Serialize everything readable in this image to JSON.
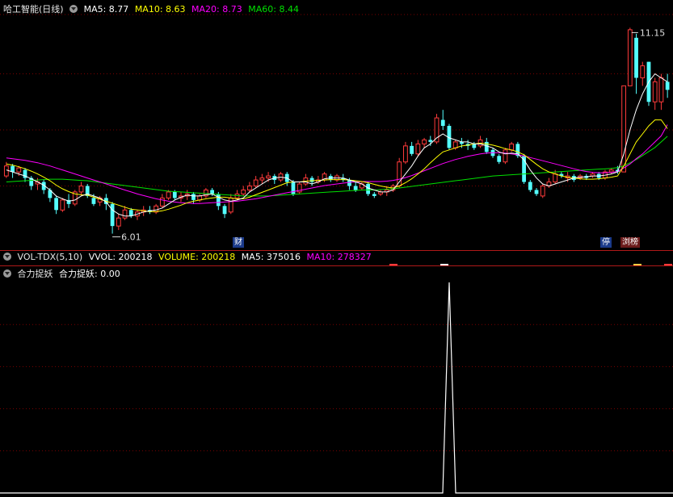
{
  "main_header": {
    "title": "哈工智能(日线)",
    "ma5": "MA5: 8.77",
    "ma10": "MA10: 8.63",
    "ma20": "MA20: 8.73",
    "ma60": "MA60: 8.44"
  },
  "vol_header": {
    "name": "VOL-TDX(5,10)",
    "vvol": "VVOL: 200218",
    "volume": "VOLUME: 200218",
    "ma5": "MA5: 375016",
    "ma10": "MA10: 278327"
  },
  "ind_header": {
    "name": "合力捉妖",
    "value": "合力捉妖: 0.00"
  },
  "badges": {
    "cai": "财",
    "ting": "停",
    "liubang": "浏榜"
  },
  "colors": {
    "up": "#ff3b3b",
    "down": "#54ffff",
    "ma5": "#ffffff",
    "ma10": "#ffff00",
    "ma20": "#ff00ff",
    "ma60": "#00e000",
    "grid": "#7a0000"
  },
  "chart_data": [
    {
      "type": "candlestick",
      "title": "哈工智能(日线)",
      "ylim": [
        5.8,
        11.4
      ],
      "annotations": {
        "high": "11.15",
        "low": "6.01"
      },
      "candles": [
        [
          7.45,
          7.7,
          7.4,
          7.8
        ],
        [
          7.7,
          7.55,
          7.4,
          7.75
        ],
        [
          7.55,
          7.65,
          7.45,
          7.7
        ],
        [
          7.6,
          7.4,
          7.3,
          7.65
        ],
        [
          7.4,
          7.2,
          7.1,
          7.45
        ],
        [
          7.25,
          7.3,
          7.1,
          7.4
        ],
        [
          7.3,
          7.1,
          7.0,
          7.35
        ],
        [
          7.1,
          6.9,
          6.8,
          7.15
        ],
        [
          6.9,
          6.6,
          6.5,
          6.95
        ],
        [
          6.6,
          6.85,
          6.55,
          6.9
        ],
        [
          6.85,
          6.75,
          6.65,
          7.0
        ],
        [
          6.75,
          7.05,
          6.7,
          7.1
        ],
        [
          7.05,
          7.2,
          6.95,
          7.3
        ],
        [
          7.2,
          6.95,
          6.9,
          7.25
        ],
        [
          6.9,
          6.75,
          6.7,
          7.0
        ],
        [
          6.8,
          6.9,
          6.7,
          6.95
        ],
        [
          6.9,
          6.75,
          6.6,
          7.0
        ],
        [
          6.75,
          6.2,
          6.01,
          6.8
        ],
        [
          6.2,
          6.4,
          6.1,
          6.5
        ],
        [
          6.4,
          6.6,
          6.35,
          6.7
        ],
        [
          6.6,
          6.45,
          6.4,
          6.65
        ],
        [
          6.45,
          6.55,
          6.35,
          6.6
        ],
        [
          6.55,
          6.6,
          6.45,
          6.7
        ],
        [
          6.6,
          6.55,
          6.5,
          6.7
        ],
        [
          6.55,
          6.7,
          6.5,
          6.75
        ],
        [
          6.7,
          6.9,
          6.65,
          7.0
        ],
        [
          6.9,
          7.05,
          6.85,
          7.1
        ],
        [
          7.05,
          6.9,
          6.85,
          7.1
        ],
        [
          6.9,
          6.95,
          6.8,
          7.05
        ],
        [
          6.95,
          7.0,
          6.85,
          7.1
        ],
        [
          7.0,
          6.85,
          6.75,
          7.05
        ],
        [
          6.85,
          6.95,
          6.8,
          7.0
        ],
        [
          6.95,
          7.1,
          6.9,
          7.15
        ],
        [
          7.1,
          7.0,
          6.95,
          7.15
        ],
        [
          7.0,
          6.7,
          6.6,
          7.05
        ],
        [
          6.7,
          6.5,
          6.4,
          6.75
        ],
        [
          6.55,
          6.9,
          6.5,
          7.0
        ],
        [
          6.9,
          7.0,
          6.85,
          7.1
        ],
        [
          7.0,
          7.1,
          6.95,
          7.2
        ],
        [
          7.1,
          7.2,
          7.05,
          7.3
        ],
        [
          7.2,
          7.35,
          7.15,
          7.45
        ],
        [
          7.35,
          7.4,
          7.25,
          7.5
        ],
        [
          7.4,
          7.45,
          7.3,
          7.55
        ],
        [
          7.45,
          7.35,
          7.25,
          7.5
        ],
        [
          7.35,
          7.5,
          7.3,
          7.55
        ],
        [
          7.5,
          7.3,
          7.2,
          7.55
        ],
        [
          7.3,
          7.0,
          6.95,
          7.35
        ],
        [
          7.05,
          7.25,
          7.0,
          7.3
        ],
        [
          7.25,
          7.4,
          7.2,
          7.5
        ],
        [
          7.4,
          7.3,
          7.2,
          7.45
        ],
        [
          7.3,
          7.35,
          7.25,
          7.45
        ],
        [
          7.35,
          7.5,
          7.3,
          7.55
        ],
        [
          7.45,
          7.35,
          7.3,
          7.5
        ],
        [
          7.35,
          7.45,
          7.3,
          7.5
        ],
        [
          7.4,
          7.35,
          7.3,
          7.5
        ],
        [
          7.35,
          7.2,
          7.1,
          7.4
        ],
        [
          7.2,
          7.1,
          7.05,
          7.3
        ],
        [
          7.15,
          7.25,
          7.1,
          7.3
        ],
        [
          7.25,
          7.0,
          6.95,
          7.3
        ],
        [
          7.0,
          6.95,
          6.9,
          7.05
        ],
        [
          7.0,
          7.05,
          6.95,
          7.1
        ],
        [
          7.05,
          7.1,
          6.95,
          7.2
        ],
        [
          7.1,
          7.2,
          7.05,
          7.25
        ],
        [
          7.2,
          7.8,
          7.15,
          7.9
        ],
        [
          7.8,
          8.2,
          7.75,
          8.3
        ],
        [
          8.2,
          8.0,
          7.95,
          8.3
        ],
        [
          8.0,
          8.25,
          7.95,
          8.35
        ],
        [
          8.25,
          8.35,
          8.15,
          8.4
        ],
        [
          8.35,
          8.3,
          8.2,
          8.45
        ],
        [
          8.3,
          8.9,
          8.25,
          9.0
        ],
        [
          8.85,
          8.7,
          8.6,
          9.1
        ],
        [
          8.7,
          8.15,
          8.1,
          8.75
        ],
        [
          8.15,
          8.3,
          8.1,
          8.35
        ],
        [
          8.3,
          8.25,
          8.15,
          8.4
        ],
        [
          8.25,
          8.2,
          8.1,
          8.35
        ],
        [
          8.25,
          8.15,
          8.1,
          8.3
        ],
        [
          8.2,
          8.35,
          8.15,
          8.45
        ],
        [
          8.3,
          8.05,
          8.0,
          8.4
        ],
        [
          8.1,
          7.95,
          7.9,
          8.15
        ],
        [
          7.95,
          7.8,
          7.75,
          8.0
        ],
        [
          7.8,
          8.1,
          7.75,
          8.15
        ],
        [
          8.1,
          8.25,
          8.05,
          8.3
        ],
        [
          8.25,
          7.95,
          7.9,
          8.3
        ],
        [
          7.95,
          7.3,
          7.25,
          8.0
        ],
        [
          7.3,
          7.1,
          7.05,
          7.35
        ],
        [
          7.1,
          7.0,
          6.95,
          7.15
        ],
        [
          6.95,
          7.2,
          6.9,
          7.25
        ],
        [
          7.2,
          7.3,
          7.15,
          7.4
        ],
        [
          7.3,
          7.5,
          7.25,
          7.6
        ],
        [
          7.5,
          7.45,
          7.4,
          7.55
        ],
        [
          7.4,
          7.45,
          7.3,
          7.55
        ],
        [
          7.45,
          7.35,
          7.3,
          7.5
        ],
        [
          7.4,
          7.45,
          7.35,
          7.5
        ],
        [
          7.45,
          7.4,
          7.35,
          7.5
        ],
        [
          7.45,
          7.5,
          7.4,
          7.55
        ],
        [
          7.5,
          7.4,
          7.35,
          7.55
        ],
        [
          7.4,
          7.55,
          7.35,
          7.6
        ],
        [
          7.55,
          7.6,
          7.5,
          7.65
        ],
        [
          7.6,
          7.55,
          7.5,
          7.7
        ],
        [
          7.55,
          9.7,
          7.55,
          9.7
        ],
        [
          9.7,
          11.1,
          9.7,
          11.15
        ],
        [
          10.9,
          9.9,
          9.5,
          11.0
        ],
        [
          9.9,
          10.2,
          9.7,
          10.3
        ],
        [
          10.3,
          9.3,
          9.2,
          10.3
        ],
        [
          9.3,
          9.8,
          9.1,
          9.9
        ],
        [
          9.3,
          9.9,
          9.1,
          10.0
        ],
        [
          9.8,
          9.6,
          9.4,
          10.0
        ]
      ],
      "ma5": [
        7.6,
        7.55,
        7.5,
        7.45,
        7.38,
        7.3,
        7.22,
        7.1,
        6.95,
        6.88,
        6.82,
        6.85,
        6.95,
        7.0,
        6.95,
        6.9,
        6.8,
        6.6,
        6.5,
        6.45,
        6.45,
        6.5,
        6.55,
        6.58,
        6.6,
        6.65,
        6.75,
        6.85,
        6.92,
        6.97,
        6.95,
        6.95,
        6.98,
        7.0,
        6.92,
        6.85,
        6.82,
        6.85,
        6.9,
        7.05,
        7.15,
        7.25,
        7.35,
        7.4,
        7.42,
        7.4,
        7.3,
        7.3,
        7.3,
        7.25,
        7.3,
        7.38,
        7.4,
        7.4,
        7.4,
        7.35,
        7.3,
        7.25,
        7.15,
        7.1,
        7.05,
        7.05,
        7.1,
        7.3,
        7.5,
        7.7,
        7.95,
        8.15,
        8.25,
        8.4,
        8.5,
        8.4,
        8.35,
        8.3,
        8.3,
        8.25,
        8.25,
        8.2,
        8.15,
        8.05,
        8.0,
        8.02,
        8.0,
        7.85,
        7.6,
        7.4,
        7.25,
        7.2,
        7.25,
        7.3,
        7.35,
        7.4,
        7.42,
        7.43,
        7.45,
        7.45,
        7.47,
        7.5,
        7.55,
        8.0,
        8.6,
        9.1,
        9.5,
        9.8,
        10.0,
        9.9,
        9.8
      ],
      "ma10": [
        7.75,
        7.72,
        7.68,
        7.63,
        7.57,
        7.5,
        7.42,
        7.33,
        7.22,
        7.13,
        7.06,
        7.0,
        6.98,
        6.97,
        6.92,
        6.87,
        6.82,
        6.77,
        6.72,
        6.67,
        6.62,
        6.6,
        6.58,
        6.56,
        6.56,
        6.58,
        6.62,
        6.67,
        6.72,
        6.78,
        6.82,
        6.85,
        6.88,
        6.9,
        6.92,
        6.92,
        6.9,
        6.88,
        6.88,
        6.92,
        6.98,
        7.04,
        7.1,
        7.16,
        7.22,
        7.28,
        7.3,
        7.3,
        7.32,
        7.33,
        7.34,
        7.35,
        7.36,
        7.36,
        7.36,
        7.35,
        7.33,
        7.31,
        7.28,
        7.24,
        7.2,
        7.17,
        7.15,
        7.2,
        7.28,
        7.38,
        7.5,
        7.63,
        7.78,
        7.92,
        8.05,
        8.1,
        8.15,
        8.2,
        8.22,
        8.25,
        8.27,
        8.25,
        8.22,
        8.18,
        8.13,
        8.1,
        8.05,
        7.98,
        7.86,
        7.74,
        7.63,
        7.55,
        7.5,
        7.45,
        7.42,
        7.4,
        7.38,
        7.37,
        7.37,
        7.38,
        7.4,
        7.42,
        7.45,
        7.7,
        8.0,
        8.3,
        8.5,
        8.7,
        8.85,
        8.85,
        8.63
      ],
      "ma20": [
        7.9,
        7.88,
        7.86,
        7.84,
        7.81,
        7.78,
        7.74,
        7.7,
        7.65,
        7.6,
        7.55,
        7.5,
        7.45,
        7.4,
        7.35,
        7.3,
        7.25,
        7.2,
        7.15,
        7.1,
        7.05,
        7.0,
        6.96,
        6.92,
        6.88,
        6.85,
        6.82,
        6.8,
        6.78,
        6.77,
        6.76,
        6.76,
        6.77,
        6.78,
        6.79,
        6.8,
        6.81,
        6.82,
        6.84,
        6.86,
        6.88,
        6.91,
        6.94,
        6.97,
        7.0,
        7.03,
        7.06,
        7.09,
        7.12,
        7.15,
        7.18,
        7.21,
        7.23,
        7.25,
        7.27,
        7.29,
        7.3,
        7.31,
        7.31,
        7.31,
        7.31,
        7.32,
        7.34,
        7.37,
        7.41,
        7.46,
        7.52,
        7.58,
        7.64,
        7.7,
        7.76,
        7.81,
        7.86,
        7.9,
        7.94,
        7.97,
        8.0,
        8.02,
        8.03,
        8.03,
        8.02,
        8.0,
        7.98,
        7.95,
        7.91,
        7.87,
        7.83,
        7.79,
        7.75,
        7.71,
        7.67,
        7.63,
        7.59,
        7.56,
        7.54,
        7.53,
        7.53,
        7.54,
        7.56,
        7.65,
        7.75,
        7.88,
        8.0,
        8.15,
        8.3,
        8.45,
        8.73
      ],
      "ma60": [
        7.3,
        7.31,
        7.32,
        7.33,
        7.34,
        7.35,
        7.36,
        7.37,
        7.37,
        7.37,
        7.36,
        7.35,
        7.34,
        7.33,
        7.31,
        7.29,
        7.27,
        7.25,
        7.23,
        7.21,
        7.19,
        7.17,
        7.15,
        7.13,
        7.11,
        7.09,
        7.07,
        7.06,
        7.05,
        7.04,
        7.03,
        7.02,
        7.01,
        7.0,
        6.99,
        6.98,
        6.97,
        6.96,
        6.95,
        6.95,
        6.95,
        6.95,
        6.95,
        6.96,
        6.97,
        6.98,
        6.99,
        7.0,
        7.01,
        7.02,
        7.03,
        7.04,
        7.05,
        7.06,
        7.07,
        7.08,
        7.09,
        7.1,
        7.1,
        7.1,
        7.11,
        7.12,
        7.13,
        7.15,
        7.17,
        7.19,
        7.21,
        7.23,
        7.25,
        7.27,
        7.29,
        7.31,
        7.33,
        7.35,
        7.37,
        7.39,
        7.41,
        7.43,
        7.45,
        7.46,
        7.47,
        7.48,
        7.49,
        7.5,
        7.51,
        7.52,
        7.53,
        7.54,
        7.55,
        7.56,
        7.57,
        7.58,
        7.59,
        7.6,
        7.61,
        7.62,
        7.63,
        7.64,
        7.66,
        7.7,
        7.78,
        7.86,
        7.96,
        8.06,
        8.16,
        8.3,
        8.44
      ]
    },
    {
      "type": "line",
      "title": "合力捉妖",
      "ylim": [
        0,
        100
      ],
      "spike": {
        "index": 71,
        "value": 100
      },
      "current_value": 0.0
    }
  ]
}
